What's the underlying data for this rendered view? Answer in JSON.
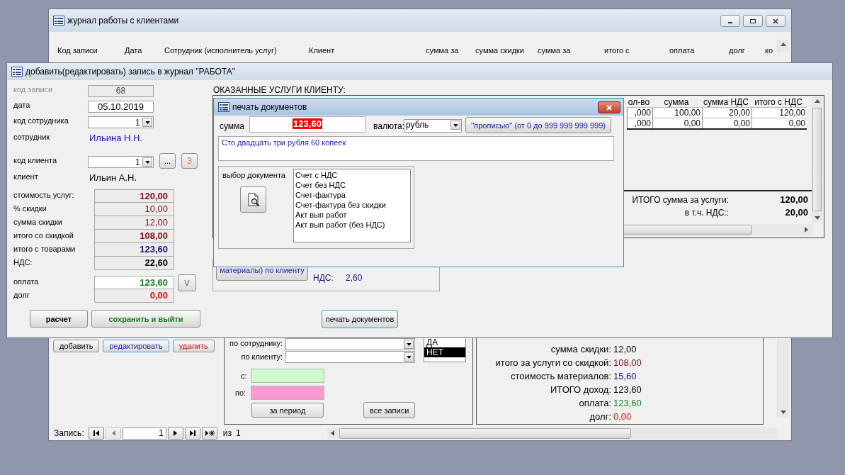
{
  "journal": {
    "title": "журнал работы с клиентами",
    "columns": [
      "Код записи",
      "Дата",
      "Сотрудник (исполнитель услуг)",
      "Клиент",
      "сумма за",
      "сумма скидки",
      "сумма за",
      "итого с",
      "оплата",
      "долг",
      "ко"
    ],
    "buttons": [
      {
        "label": "добавить",
        "kind": "plain"
      },
      {
        "label": "редактировать",
        "kind": "focused"
      },
      {
        "label": "удалить",
        "kind": "danger"
      }
    ],
    "filter": {
      "employee_label": "по сотруднику:",
      "client_label": "по клиенту:",
      "from_label": "с:",
      "to_label": "по:",
      "period_button": "за период",
      "all_button": "все записи",
      "options": [
        {
          "label": "ДА",
          "selected": false
        },
        {
          "label": "НЕТ",
          "selected": true
        }
      ]
    },
    "stats": [
      {
        "label": "сумма скидки:",
        "value": "12,00",
        "color": "#000000"
      },
      {
        "label": "итого за услуги со скидкой:",
        "value": "108,00",
        "color": "#7a1010"
      },
      {
        "label": "стоимость материалов:",
        "value": "15,60",
        "color": "#14146e"
      },
      {
        "label": "ИТОГО  доход:",
        "value": "123,60",
        "color": "#000000"
      },
      {
        "label": "оплата:",
        "value": "123,60",
        "color": "#1a7a1a"
      },
      {
        "label": "долг:",
        "value": "0,00",
        "color": "#d01010"
      }
    ],
    "nav": {
      "label": "Запись:",
      "current": "1",
      "of": "из",
      "total": "1",
      "prev_disabled": true
    }
  },
  "editor": {
    "title": "добавить(редактировать) запись в журнал \"РАБОТА\"",
    "fields": [
      {
        "kind": "readonly",
        "label": "код записи",
        "value": "68"
      },
      {
        "kind": "input",
        "label": "дата",
        "value": "05.10.2019"
      },
      {
        "kind": "combo",
        "label": "код сотрудника",
        "value": "1"
      },
      {
        "kind": "text",
        "label": "сотрудник",
        "value": "Ильина Н.Н.",
        "color": "#1a1aa0"
      },
      {
        "kind": "combo",
        "label": "код клиента",
        "value": "1"
      },
      {
        "kind": "text",
        "label": "клиент",
        "value": "Ильин А.Н.",
        "color": "#000000"
      }
    ],
    "client_buttons": [
      "...",
      "3"
    ],
    "totals": [
      {
        "label": "стоимость услуг:",
        "value": "120,00",
        "color": "#7a1010",
        "bold": true
      },
      {
        "label": "% скидки",
        "value": "10,00",
        "color": "#7a1010",
        "bold": false
      },
      {
        "label": "сумма скидки",
        "value": "12,00",
        "color": "#7a1010",
        "bold": false
      },
      {
        "label": "итого со скидкой",
        "value": "108,00",
        "color": "#7a1010",
        "bold": true
      },
      {
        "label": "итого с товарами",
        "value": "123,60",
        "color": "#14146e",
        "bold": true
      },
      {
        "label": "НДС:",
        "value": "22,60",
        "color": "#000000",
        "bold": true
      }
    ],
    "payment": [
      {
        "label": "оплата",
        "value": "123,60",
        "color": "#1a7a1a",
        "editable": true
      },
      {
        "label": "долг",
        "value": "0,00",
        "color": "#d01010",
        "editable": false
      }
    ],
    "confirm_button": "V",
    "buttons": [
      "расчет",
      "сохранить и выйти"
    ],
    "services": {
      "title": "ОКАЗАННЫЕ УСЛУГИ КЛИЕНТУ:",
      "columns": [
        "ол-во",
        "сумма",
        "сумма НДС",
        "итого с НДС"
      ],
      "rows": [
        [
          ",000",
          "100,00",
          "20,00",
          "120,00"
        ],
        [
          ",000",
          "0,00",
          "0,00",
          "0,00"
        ]
      ],
      "total_label": "ИТОГО сумма за услуги:",
      "total_value": "120,00",
      "vat_label": "в т.ч. НДС::",
      "vat_value": "20,00"
    },
    "materials": {
      "button": "материалы) по клиенту",
      "vat_label": "НДС:",
      "vat_value": "2,60"
    },
    "print_button": "печать документов"
  },
  "dialog": {
    "title": "печать документов",
    "sum_label": "сумма",
    "sum_value": "123,60",
    "currency_label": "валюта:",
    "currency": "рубль",
    "words_button": "''прописью'' (от 0 до 999 999 999 999)",
    "words": "Сто двадцать три рубля 60 копеек",
    "doc_label": "выбор документа",
    "documents": [
      {
        "label": "Счет с НДС",
        "selected": false
      },
      {
        "label": "Счет без НДС",
        "selected": false
      },
      {
        "label": "Счет-фактура",
        "selected": false
      },
      {
        "label": "Счет-фактура без скидки",
        "selected": false
      },
      {
        "label": "Акт вып работ",
        "selected": false
      },
      {
        "label": "Акт вып работ (без НДС)",
        "selected": false
      }
    ]
  }
}
